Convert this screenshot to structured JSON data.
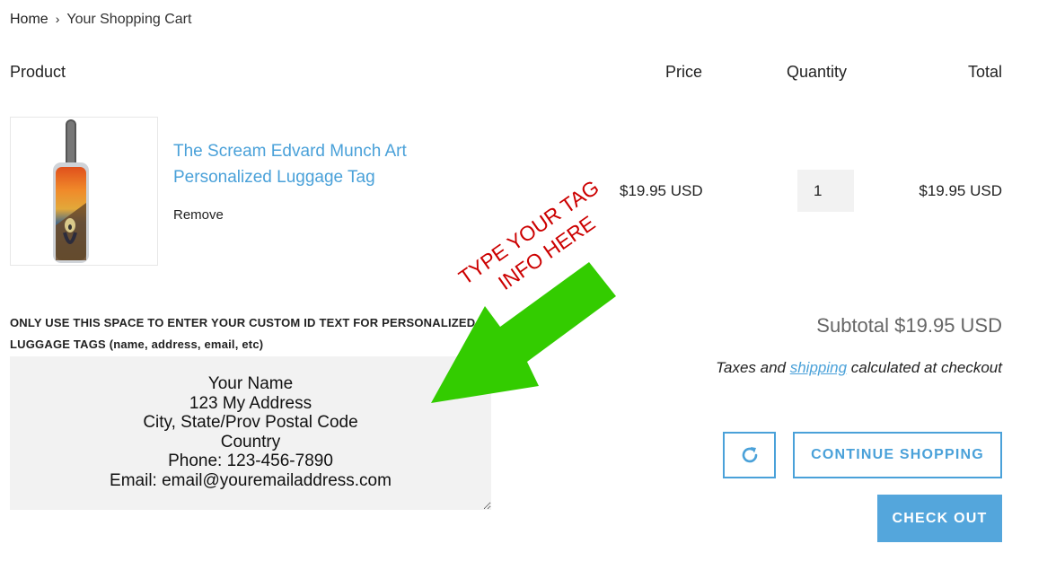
{
  "breadcrumb": {
    "home": "Home",
    "separator": "›",
    "current": "Your Shopping Cart"
  },
  "table_headers": {
    "product": "Product",
    "price": "Price",
    "quantity": "Quantity",
    "total": "Total"
  },
  "cart_item": {
    "title": "The Scream Edvard Munch Art Personalized Luggage Tag",
    "remove": "Remove",
    "price": "$19.95 USD",
    "quantity": "1",
    "line_total": "$19.95 USD"
  },
  "note": {
    "label_upper": "ONLY USE THIS SPACE TO ENTER YOUR CUSTOM ID TEXT FOR PERSONALIZED LUGGAGE TAGS",
    "label_lower": "(name, address, email, etc)",
    "value": "Your Name\n123 My Address\nCity, State/Prov Postal Code\nCountry\nPhone: 123-456-7890\nEmail: email@youremailaddress.com"
  },
  "summary": {
    "subtotal": "Subtotal $19.95 USD",
    "taxes_before": "Taxes and ",
    "taxes_link": "shipping",
    "taxes_after": " calculated at checkout"
  },
  "buttons": {
    "update_icon": "refresh-icon",
    "continue": "CONTINUE SHOPPING",
    "checkout": "CHECK OUT"
  },
  "annotation": {
    "line1": "TYPE YOUR TAG",
    "line2": "INFO HERE"
  },
  "colors": {
    "accent": "#4aa1d9",
    "checkout_bg": "#54a6dc",
    "arrow": "#33cc00",
    "annotation_text": "#cc0000",
    "field_bg": "#f2f2f2"
  }
}
